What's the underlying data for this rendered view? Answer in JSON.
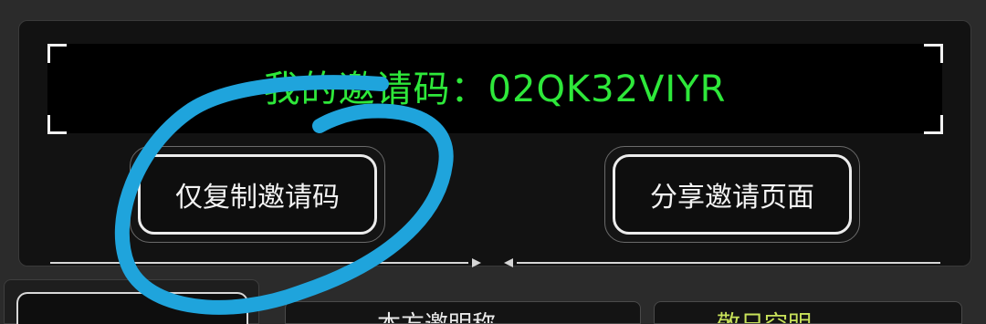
{
  "invite": {
    "label": "我的邀请码：",
    "code": "02QK32VIYR"
  },
  "buttons": {
    "copy_code": "仅复制邀请码",
    "share_page": "分享邀请页面"
  },
  "bottom": {
    "tab_center_text": "本方邀明称",
    "tab_right_text": "敬日空明"
  },
  "colors": {
    "code_green": "#2ee83a",
    "annotation_blue": "#1fa4dc"
  }
}
